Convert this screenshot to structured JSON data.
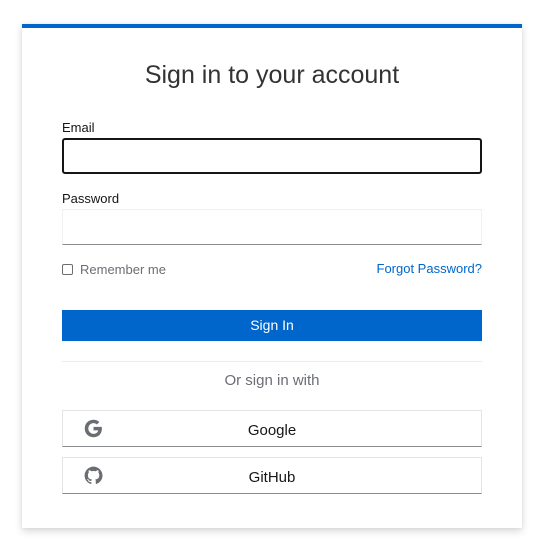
{
  "page": {
    "title": "Sign in to your account"
  },
  "form": {
    "email_label": "Email",
    "email_value": "",
    "password_label": "Password",
    "password_value": "",
    "remember_label": "Remember me",
    "remember_checked": false,
    "forgot_label": "Forgot Password?",
    "submit_label": "Sign In"
  },
  "social": {
    "heading": "Or sign in with",
    "providers": [
      {
        "label": "Google",
        "icon": "google-icon"
      },
      {
        "label": "GitHub",
        "icon": "github-icon"
      }
    ]
  },
  "colors": {
    "accent": "#0066cc",
    "text": "#151515",
    "muted": "#6a6e73",
    "border": "#8a8d90"
  }
}
